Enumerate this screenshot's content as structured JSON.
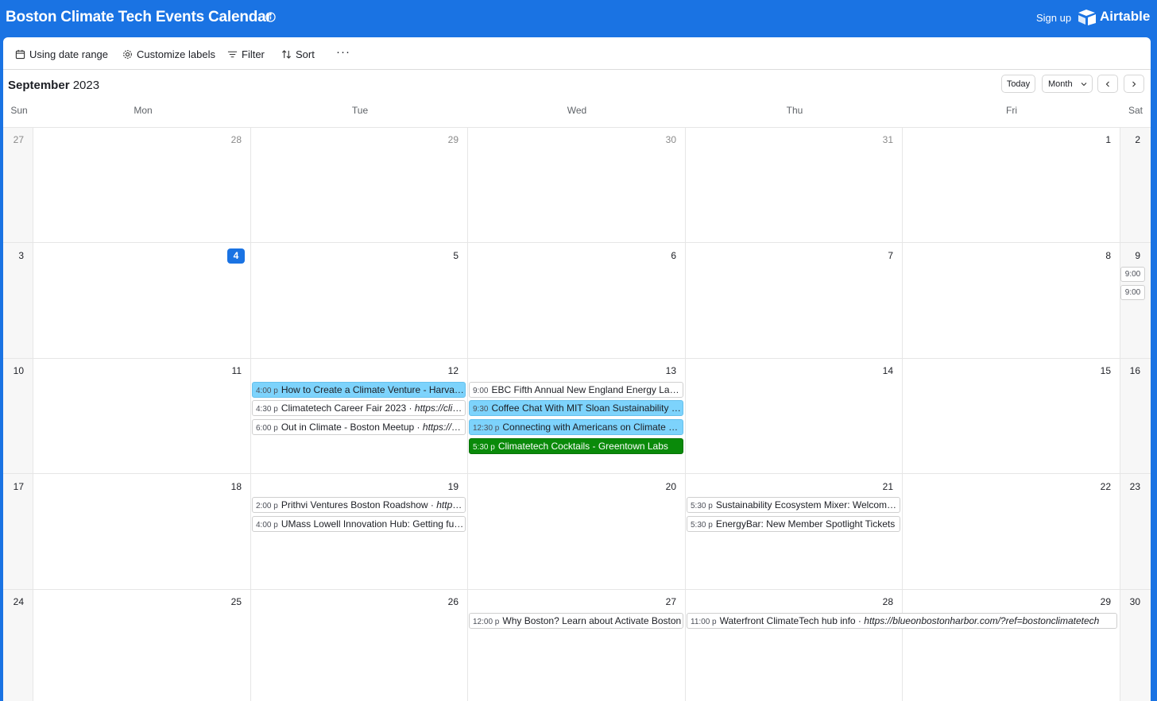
{
  "app": {
    "title": "Boston Climate Tech Events Calendar",
    "signup": "Sign up",
    "brand": "Airtable"
  },
  "toolbar": {
    "date_range": "Using date range",
    "customize": "Customize labels",
    "filter": "Filter",
    "sort": "Sort",
    "more": "···"
  },
  "calendar": {
    "month": "September",
    "year": "2023",
    "controls": {
      "today": "Today",
      "view": "Month"
    },
    "weekdays": [
      "Sun",
      "Mon",
      "Tue",
      "Wed",
      "Thu",
      "Fri",
      "Sat"
    ],
    "weeks": [
      [
        "27",
        "28",
        "29",
        "30",
        "31",
        "1",
        "2"
      ],
      [
        "3",
        "4",
        "5",
        "6",
        "7",
        "8",
        "9"
      ],
      [
        "10",
        "11",
        "12",
        "13",
        "14",
        "15",
        "16"
      ],
      [
        "17",
        "18",
        "19",
        "20",
        "21",
        "22",
        "23"
      ],
      [
        "24",
        "25",
        "26",
        "27",
        "28",
        "29",
        "30"
      ]
    ],
    "today": "4",
    "sat_chips": [
      "9:00",
      "9:00"
    ],
    "events": {
      "tue12": [
        {
          "time": "4:00 p",
          "title": "How to Create a Climate Venture - Harvard Innovation Labs",
          "color": "#7dd3fc"
        },
        {
          "time": "4:30 p",
          "title": "Climatetech Career Fair 2023  · ",
          "link": "https://climatetech-careerfair.com"
        },
        {
          "time": "6:00 p",
          "title": "Out in Climate - Boston Meetup · ",
          "link": "https://outinclimate.org"
        }
      ],
      "wed13": [
        {
          "time": "9:00",
          "title": "EBC Fifth Annual New England Energy Law Conference"
        },
        {
          "time": "9:30",
          "title": "Coffee Chat With MIT Sloan Sustainability Initiative",
          "color": "#7dd3fc"
        },
        {
          "time": "12:30 p",
          "title": "Connecting with Americans on Climate Change",
          "color": "#7dd3fc"
        },
        {
          "time": "5:30 p",
          "title": "Climatetech Cocktails - Greentown Labs",
          "color": "#0a8a0a"
        }
      ],
      "tue19": [
        {
          "time": "2:00 p",
          "title": "Prithvi Ventures Boston Roadshow · ",
          "link": "https://prithvi.vc"
        },
        {
          "time": "4:00 p",
          "title": "UMass Lowell Innovation Hub: Getting funded"
        }
      ],
      "thu21": [
        {
          "time": "5:30 p",
          "title": "Sustainability Ecosystem Mixer: Welcome Back"
        },
        {
          "time": "5:30 p",
          "title": "EnergyBar: New Member Spotlight Tickets"
        }
      ],
      "wed27": [
        {
          "time": "12:00 p",
          "title": "Why Boston? Learn about Activate Boston"
        }
      ],
      "thu28": [
        {
          "time": "11:00 p",
          "title": "Waterfront ClimateTech hub info · ",
          "link": "https://blueonbostonharbor.com/?ref=bostonclimatetech"
        }
      ]
    }
  }
}
